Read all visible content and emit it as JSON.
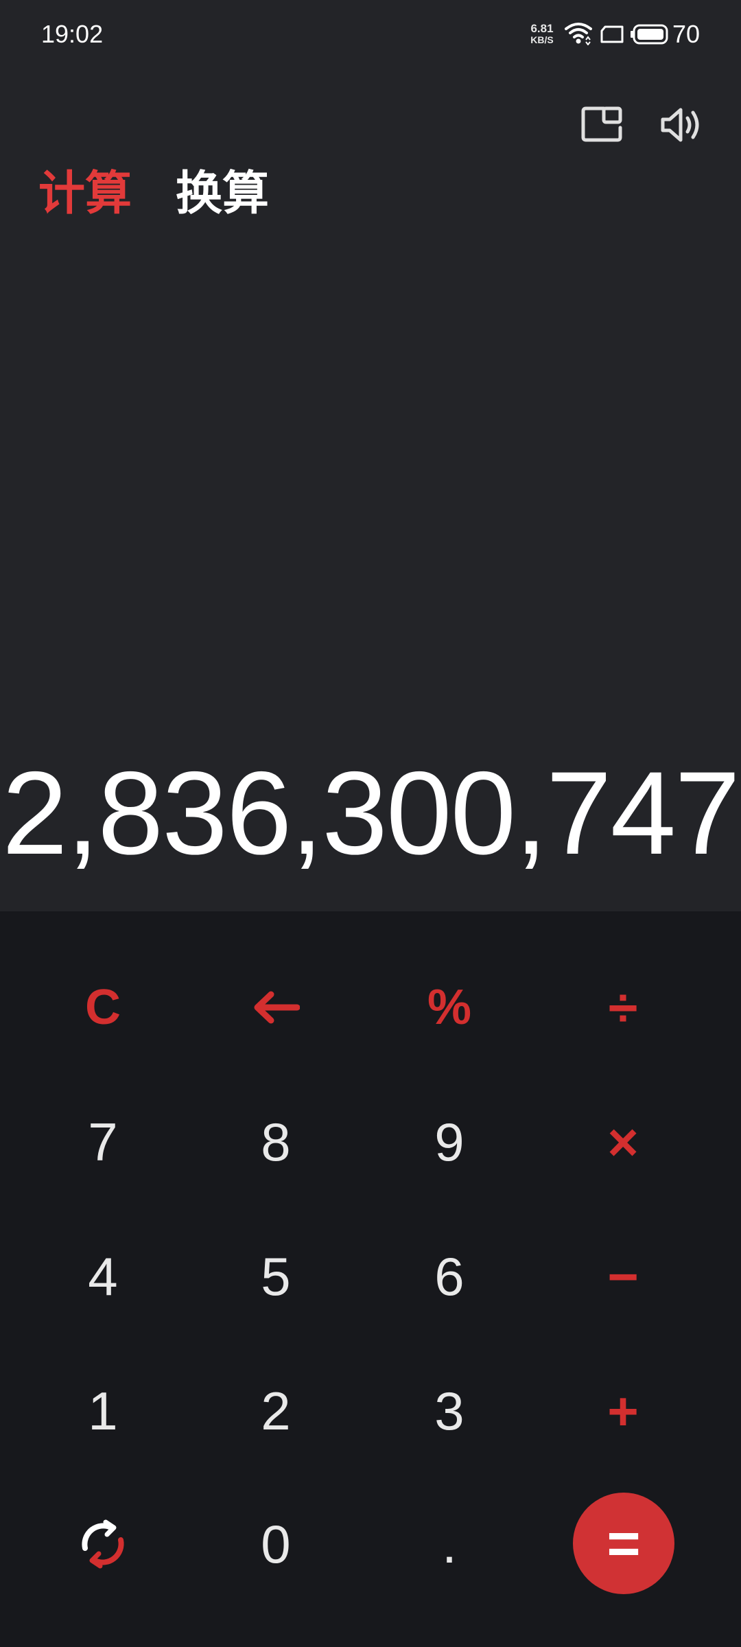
{
  "status_bar": {
    "time": "19:02",
    "net_speed_value": "6.81",
    "net_speed_unit": "KB/S",
    "battery_level": "70"
  },
  "tabs": [
    {
      "label": "计算",
      "active": true
    },
    {
      "label": "换算",
      "active": false
    }
  ],
  "result": "2,836,300,747",
  "keypad": {
    "clear": "C",
    "backspace": "←",
    "percent": "%",
    "divide": "÷",
    "seven": "7",
    "eight": "8",
    "nine": "9",
    "multiply": "×",
    "four": "4",
    "five": "5",
    "six": "6",
    "minus": "−",
    "one": "1",
    "two": "2",
    "three": "3",
    "plus": "+",
    "zero": "0",
    "decimal": ".",
    "equals": "="
  },
  "icons": {
    "float_window": "float-window-icon",
    "sound": "speaker-icon",
    "wifi": "wifi-icon",
    "battery": "battery-icon",
    "rotate": "rotate-icon"
  },
  "colors": {
    "accent": "#d32f2f",
    "display_bg": "#232428",
    "keypad_bg": "#17181c",
    "digit_text": "#e9e9e9",
    "active_tab": "#e23a3a"
  }
}
